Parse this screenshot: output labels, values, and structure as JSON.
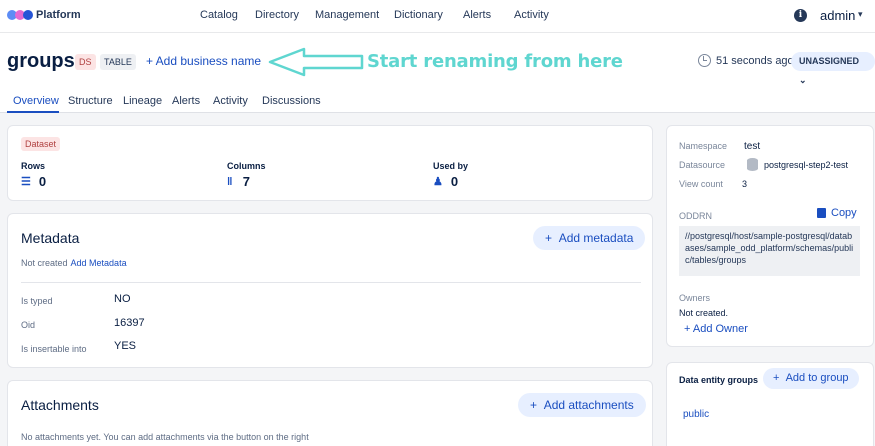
{
  "app": {
    "name": "Platform",
    "logo_colors": [
      "#5c8cf5",
      "#e36ad1",
      "#2554d6"
    ]
  },
  "nav": {
    "items": [
      "Catalog",
      "Directory",
      "Management",
      "Dictionary",
      "Alerts",
      "Activity"
    ]
  },
  "user": {
    "name": "admin"
  },
  "entity": {
    "name": "groups",
    "badges": [
      "DS",
      "TABLE"
    ],
    "add_business_name": "+ Add business name",
    "updated_ago": "51 seconds ago",
    "owner_status": "UNASSIGNED"
  },
  "annotation": {
    "text": "Start renaming from here",
    "color": "#5fd6d0"
  },
  "tabs": [
    "Overview",
    "Structure",
    "Lineage",
    "Alerts",
    "Activity",
    "Discussions"
  ],
  "stats": {
    "tag": "Dataset",
    "rows_label": "Rows",
    "rows_value": "0",
    "columns_label": "Columns",
    "columns_value": "7",
    "usedby_label": "Used by",
    "usedby_value": "0"
  },
  "metadata": {
    "title": "Metadata",
    "add_button": "Add metadata",
    "not_created": "Not created",
    "add_link": "Add Metadata",
    "rows": [
      {
        "key": "Is typed",
        "value": "NO"
      },
      {
        "key": "Oid",
        "value": "16397"
      },
      {
        "key": "Is insertable into",
        "value": "YES"
      }
    ]
  },
  "attachments": {
    "title": "Attachments",
    "add_button": "Add attachments",
    "empty_text": "No attachments yet. You can add attachments via the button on the right"
  },
  "side": {
    "namespace_label": "Namespace",
    "namespace_value": "test",
    "datasource_label": "Datasource",
    "datasource_value": "postgresql-step2-test",
    "viewcount_label": "View count",
    "viewcount_value": "3",
    "oddrn_label": "ODDRN",
    "copy_label": "Copy",
    "oddrn_value": "//postgresql/host/sample-postgresql/databases/sample_odd_platform/schemas/public/tables/groups",
    "owners_label": "Owners",
    "owners_value": "Not created.",
    "add_owner": "+ Add Owner"
  },
  "groups": {
    "title": "Data entity groups",
    "add_button": "Add to group",
    "items": [
      "public"
    ]
  }
}
